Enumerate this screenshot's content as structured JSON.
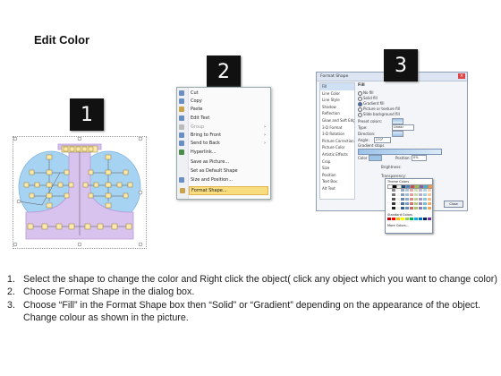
{
  "title": "Edit Color",
  "badges": [
    "1",
    "2",
    "3"
  ],
  "context_menu": {
    "items": [
      {
        "label": "Cut",
        "icon": "scissors-icon",
        "state": "normal",
        "submenu": false
      },
      {
        "label": "Copy",
        "icon": "copy-icon",
        "state": "normal",
        "submenu": false
      },
      {
        "label": "Paste",
        "icon": "paste-icon",
        "state": "normal",
        "submenu": false
      },
      {
        "label": "Edit Text",
        "icon": "text-icon",
        "state": "normal",
        "submenu": false
      },
      {
        "label": "Group",
        "icon": "group-icon",
        "state": "disabled",
        "submenu": true
      },
      {
        "label": "Bring to Front",
        "icon": "bring-front-icon",
        "state": "normal",
        "submenu": true
      },
      {
        "label": "Send to Back",
        "icon": "send-back-icon",
        "state": "normal",
        "submenu": true
      },
      {
        "label": "Hyperlink...",
        "icon": "link-icon",
        "state": "normal",
        "submenu": false
      },
      {
        "label": "Save as Picture...",
        "icon": "",
        "state": "normal",
        "submenu": false
      },
      {
        "label": "Set as Default Shape",
        "icon": "",
        "state": "normal",
        "submenu": false
      },
      {
        "label": "Size and Position...",
        "icon": "size-icon",
        "state": "normal",
        "submenu": false
      },
      {
        "label": "Format Shape...",
        "icon": "format-icon",
        "state": "selected",
        "submenu": false
      }
    ]
  },
  "format_dialog": {
    "title": "Format Shape",
    "categories": [
      "Fill",
      "Line Color",
      "Line Style",
      "Shadow",
      "Reflection",
      "Glow and Soft Edges",
      "3-D Format",
      "3-D Rotation",
      "Picture Corrections",
      "Picture Color",
      "Artistic Effects",
      "Crop",
      "Size",
      "Position",
      "Text Box",
      "Alt Text"
    ],
    "selected_category": "Fill",
    "section_heading": "Fill",
    "fill_options": [
      "No fill",
      "Solid fill",
      "Gradient fill",
      "Picture or texture fill",
      "Slide background fill"
    ],
    "selected_fill": "Gradient fill",
    "preset_label": "Preset colors:",
    "type_label": "Type:",
    "type_value": "Linear",
    "direction_label": "Direction:",
    "angle_label": "Angle:",
    "angle_value": "270°",
    "gradient_stops_label": "Gradient stops",
    "color_label": "Color",
    "position_label": "Position:",
    "position_value": "0%",
    "brightness_label": "Brightness:",
    "transparency_label": "Transparency:",
    "theme_colors_label": "Theme Colors",
    "standard_colors_label": "Standard Colors",
    "more_colors_label": "More Colors...",
    "close_button": "Close"
  },
  "colors": {
    "accent_blue": "#3a6fc1",
    "diagram_purple": "#d8c2ee",
    "diagram_blue": "#a6d3f2",
    "org_box": "#ffe9a8",
    "selected_menu": "#f8dc80"
  },
  "instructions": [
    {
      "number": "1.",
      "text": "Select the shape to change the color and Right click the object( click any object which you want to change color)"
    },
    {
      "number": "2.",
      "text": "Choose Format Shape in the dialog box."
    },
    {
      "number": "3.",
      "text": "Choose “Fill” in the Format Shape box then “Solid” or “Gradient” depending on the appearance of the object. Change colour as shown in the picture."
    }
  ]
}
